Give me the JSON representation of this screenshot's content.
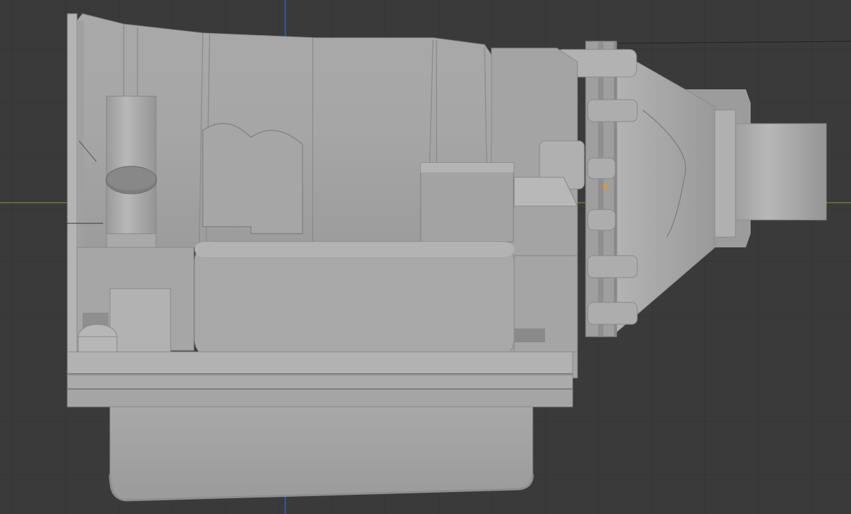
{
  "viewport": {
    "background_color": "#3a3a3a",
    "grid_minor_color": "#333333",
    "grid_major_color": "#2e2e2e",
    "x_axis_color": "#6e8f2a",
    "y_axis_color": "#2d6fc9",
    "origin_marker_color": "#ff8c1a"
  },
  "model": {
    "description_icon": "transmission-mesh-icon",
    "body_color": "#a3a3a3",
    "light_color": "#b5b5b5",
    "shadow_color": "#8a8a8a",
    "edge_color": "#6f6f6f"
  }
}
